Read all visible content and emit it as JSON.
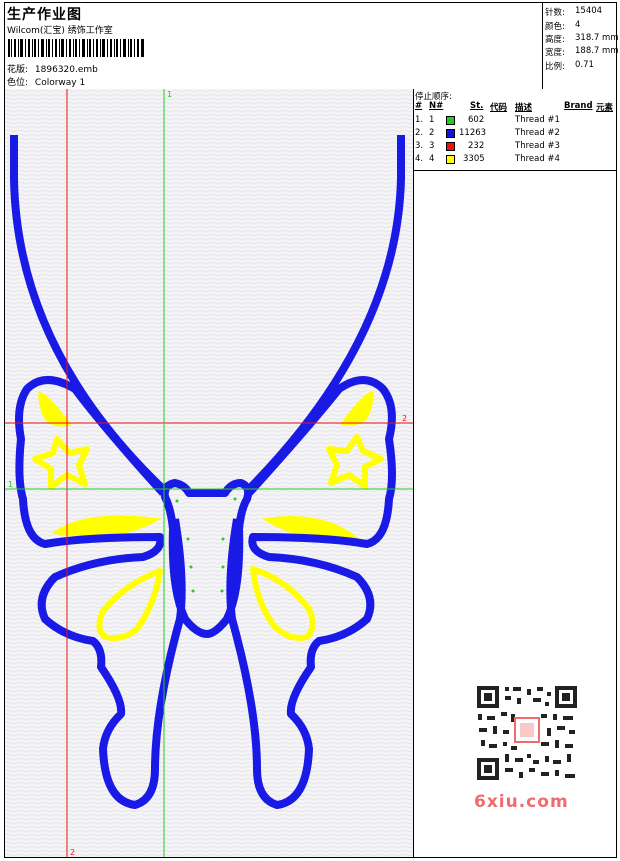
{
  "header": {
    "title": "生产作业图",
    "subtitle": "Wilcom(汇宝) 绣饰工作室",
    "design_label": "花版:",
    "design_value": "1896320.emb",
    "colorway_label": "色位:",
    "colorway_value": "Colorway 1"
  },
  "stats": [
    {
      "label": "针数:",
      "value": "15404"
    },
    {
      "label": "颜色:",
      "value": "4"
    },
    {
      "label": "高度:",
      "value": "318.7 mm"
    },
    {
      "label": "宽度:",
      "value": "188.7 mm"
    },
    {
      "label": "比例:",
      "value": "0.71"
    }
  ],
  "stop_sequence": {
    "title": "停止顺序:",
    "headers": {
      "idx": "#",
      "num": "N#",
      "st": "St.",
      "code": "代码",
      "desc": "描述",
      "brand": "Brand",
      "element": "元素"
    },
    "rows": [
      {
        "idx": "1.",
        "num": "1",
        "color": "#22cc22",
        "stitches": "602",
        "desc": "Thread #1"
      },
      {
        "idx": "2.",
        "num": "2",
        "color": "#1111dd",
        "stitches": "11263",
        "desc": "Thread #2"
      },
      {
        "idx": "3.",
        "num": "3",
        "color": "#ee1111",
        "stitches": "232",
        "desc": "Thread #3"
      },
      {
        "idx": "4.",
        "num": "4",
        "color": "#ffff00",
        "stitches": "3305",
        "desc": "Thread #4"
      }
    ]
  },
  "guides": {
    "label_1": "1",
    "label_2": "2"
  },
  "colors": {
    "outline": "#1a1ae6",
    "fill": "#ffff00",
    "green": "#22cc22",
    "red": "#ee1111"
  },
  "watermark": {
    "text": "6xiu.com"
  }
}
